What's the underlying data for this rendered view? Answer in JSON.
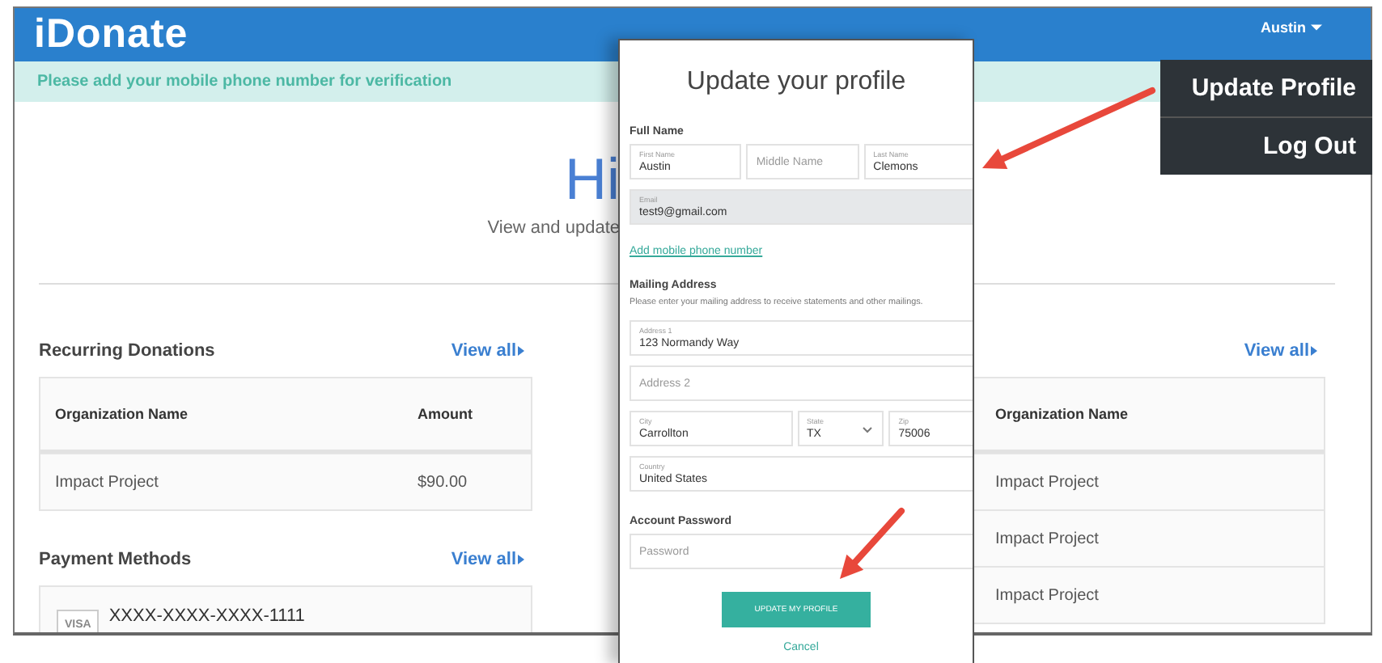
{
  "header": {
    "logo": "iDonate",
    "user_menu": {
      "label": "Austin",
      "expanded": true,
      "items": [
        {
          "label": "Update Profile"
        },
        {
          "label": "Log Out"
        }
      ]
    }
  },
  "banner": "Please add your mobile phone number for verification",
  "greeting": {
    "title": "Hi",
    "subtitle": "View and update"
  },
  "recurring_donations": {
    "title": "Recurring Donations",
    "link": "View all",
    "columns": [
      "Organization Name",
      "Amount"
    ],
    "rows": [
      [
        "Impact Project",
        "$90.00"
      ]
    ]
  },
  "payment_methods": {
    "title": "Payment Methods",
    "link": "View all",
    "cards": [
      {
        "brand": "VISA",
        "number": "XXXX-XXXX-XXXX-1111"
      }
    ]
  },
  "donations": {
    "link": "View all",
    "columns": [
      "Organization Name"
    ],
    "rows": [
      [
        "Impact Project"
      ],
      [
        "Impact Project"
      ],
      [
        "Impact Project"
      ]
    ]
  },
  "modal": {
    "title": "Update your profile",
    "items": [
      {
        "kind": "heading",
        "text": "Full Name"
      },
      {
        "kind": "fields",
        "fields": [
          {
            "kind": "text",
            "label": "First Name",
            "value": "Austin",
            "disabled": false
          },
          {
            "kind": "text",
            "placeholder": "Middle Name",
            "disabled": false
          },
          {
            "kind": "text",
            "label": "Last Name",
            "value": "Clemons",
            "disabled": false
          }
        ]
      },
      {
        "kind": "fields",
        "fields": [
          {
            "kind": "text",
            "label": "Email",
            "value": "test9@gmail.com",
            "disabled": true
          }
        ]
      },
      {
        "kind": "link",
        "text": "Add mobile phone number"
      },
      {
        "kind": "heading",
        "text": "Mailing Address"
      },
      {
        "kind": "hint",
        "text": "Please enter your mailing address to receive statements and other mailings."
      },
      {
        "kind": "fields",
        "fields": [
          {
            "kind": "text",
            "label": "Address 1",
            "value": "123 Normandy Way",
            "disabled": false
          }
        ]
      },
      {
        "kind": "fields",
        "fields": [
          {
            "kind": "text",
            "placeholder": "Address 2",
            "disabled": false
          }
        ]
      },
      {
        "kind": "fields",
        "fields": [
          {
            "kind": "text",
            "label": "City",
            "value": "Carrollton",
            "disabled": false
          },
          {
            "kind": "select",
            "label": "State",
            "value": "TX",
            "disabled": false
          },
          {
            "kind": "text",
            "label": "Zip",
            "value": "75006",
            "disabled": false
          }
        ]
      },
      {
        "kind": "fields",
        "fields": [
          {
            "kind": "text",
            "label": "Country",
            "value": "United States",
            "disabled": false
          }
        ]
      },
      {
        "kind": "heading",
        "text": "Account Password"
      },
      {
        "kind": "fields",
        "fields": [
          {
            "kind": "text",
            "placeholder": "Password",
            "disabled": false
          }
        ]
      },
      {
        "kind": "button",
        "text": "UPDATE MY PROFILE"
      },
      {
        "kind": "cancel",
        "text": "Cancel"
      }
    ]
  }
}
